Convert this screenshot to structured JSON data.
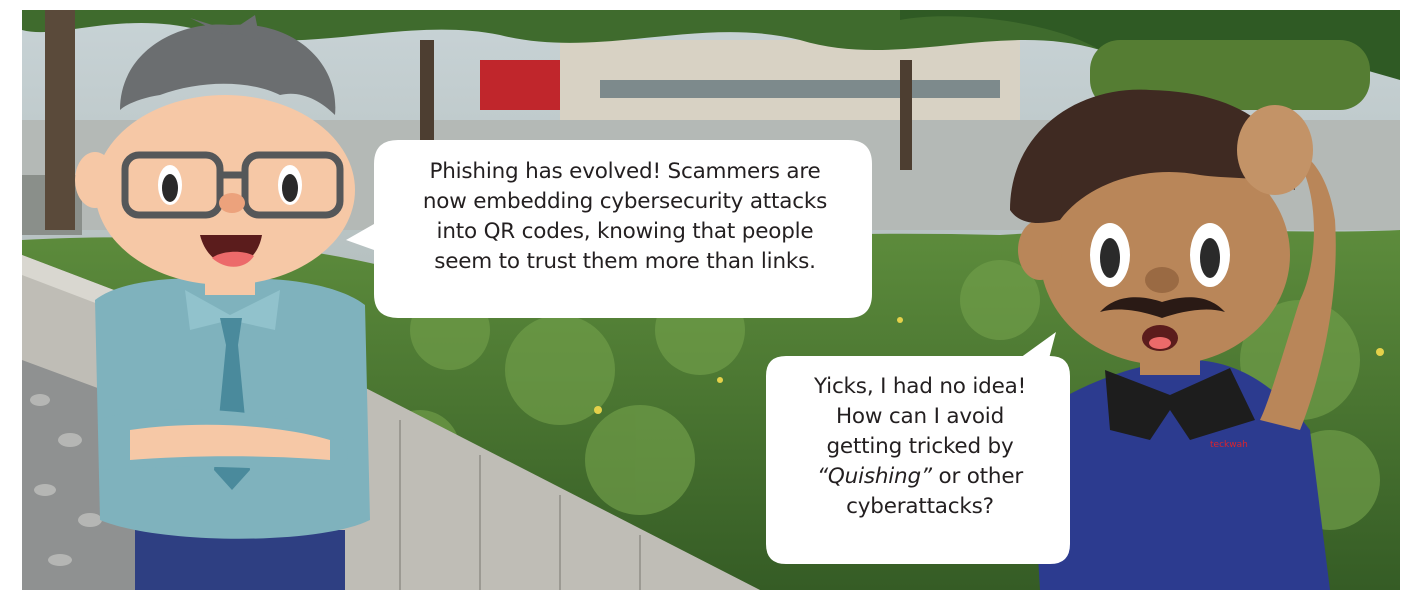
{
  "colors": {
    "sky": "#a9b7bc",
    "bush": "#4d7a34",
    "shirt_left": "#7fb2bd",
    "tie": "#4a8a9c",
    "hair_left": "#6b6e70",
    "skin_left": "#f6c8a6",
    "shirt_right": "#2c3b8f",
    "skin_right": "#b98659",
    "hair_right": "#3f2a22",
    "logo": "#d9232e"
  },
  "characters": {
    "left": {
      "role": "office worker with glasses",
      "icon": "cartoon-man-glasses-icon"
    },
    "right": {
      "role": "worker in polo shirt",
      "icon": "cartoon-man-mustache-icon",
      "shirt_logo": "teckwah"
    }
  },
  "speech": {
    "left": {
      "lines": [
        "Phishing has evolved! Scammers are",
        "now embedding cybersecurity attacks",
        "into QR codes, knowing that people",
        "seem to trust them more than links."
      ]
    },
    "right": {
      "line1": "Yicks, I had no idea!",
      "line2": "How can I avoid",
      "line3": "getting tricked by",
      "line4_italic": "“Quishing”",
      "line4_rest": " or other",
      "line5": "cyberattacks?"
    }
  }
}
